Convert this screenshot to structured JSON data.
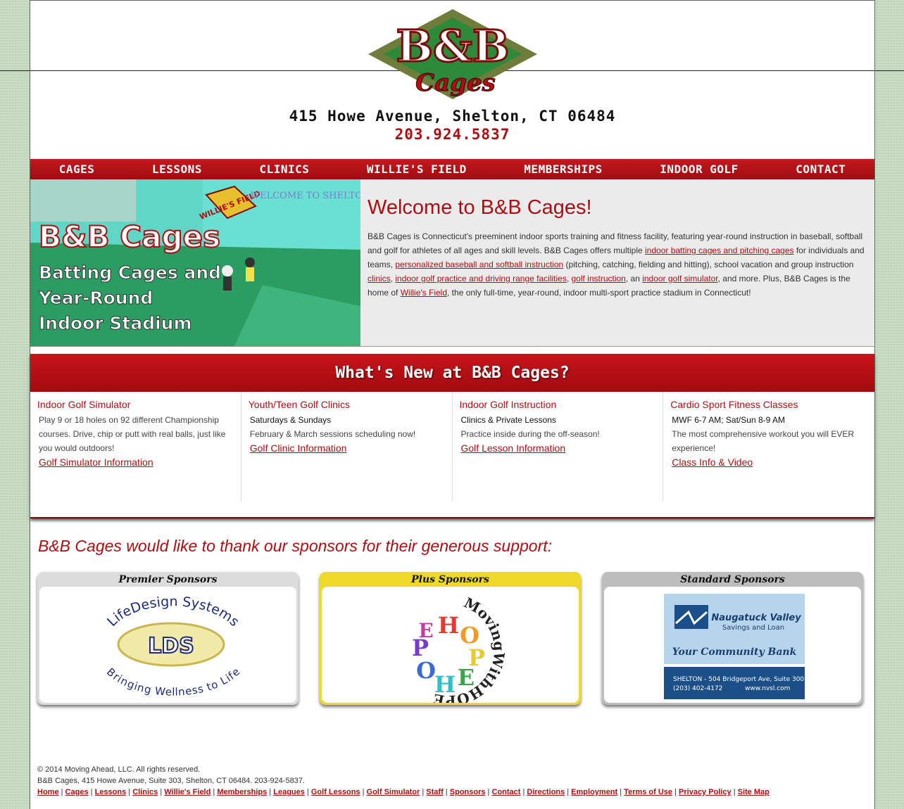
{
  "header": {
    "logo_top": "B&B",
    "logo_bottom": "Cages",
    "address": "415 Howe Avenue, Shelton, CT 06484",
    "phone": "203.924.5837"
  },
  "nav": [
    "CAGES",
    "LESSONS",
    "CLINICS",
    "WILLIE'S FIELD",
    "MEMBERSHIPS",
    "INDOOR GOLF",
    "CONTACT"
  ],
  "hero": {
    "image_title": "B&B Cages",
    "image_line1": "Batting Cages and",
    "image_line2": "Year-Round",
    "image_line3": "Indoor Stadium",
    "sign_welcome": "WELCOME TO SHELTON",
    "sign_field": "WILLIE'S FIELD",
    "heading": "Welcome to B&B Cages!",
    "p1": "B&B Cages is Connecticut's preeminent indoor sports training and fitness facility, featuring year-round instruction in baseball, softball and golf for athletes of all ages and skill levels. B&B Cages offers multiple ",
    "link1": "indoor batting cages and pitching cages",
    "p2": " for individuals and teams, ",
    "link2": "personalized baseball and softball instruction",
    "p3": " (pitching, catching, fielding and hitting), school vacation and group instruction ",
    "link3": "clinics",
    "p4": ", ",
    "link4": "indoor golf practice and driving range facilities",
    "p5": ", ",
    "link5": "golf instruction",
    "p6": ", an ",
    "link6": "indoor golf simulator",
    "p7": ", and more. Plus, B&B Cages is the home of ",
    "link7": "Willie's Field",
    "p8": ", the only full-time, year-round, indoor multi-sport practice stadium in Connecticut!"
  },
  "news": {
    "title": "What's New at B&B Cages?",
    "items": [
      {
        "title": "Indoor Golf Simulator",
        "sub": "",
        "text": "Play 9 or 18 holes on 92 different Championship courses. Drive, chip or putt with real balls, just like you would outdoors!",
        "link": "Golf Simulator Information"
      },
      {
        "title": "Youth/Teen Golf Clinics",
        "sub": "Saturdays & Sundays",
        "text": "February & March sessions scheduling now!",
        "link": "Golf Clinic Information"
      },
      {
        "title": "Indoor Golf Instruction",
        "sub": "Clinics & Private Lessons",
        "text": "Practice inside during the off-season!",
        "link": "Golf Lesson Information"
      },
      {
        "title": "Cardio Sport Fitness Classes",
        "sub": "MWF 6-7 AM; Sat/Sun 8-9 AM",
        "text": "The most comprehensive workout you will EVER experience!",
        "link": "Class Info & Video"
      }
    ]
  },
  "sponsors": {
    "thanks": "B&B Cages would like to thank our sponsors for their generous support:",
    "premier": "Premier Sponsors",
    "plus": "Plus Sponsors",
    "standard": "Standard Sponsors",
    "lds_top": "LifeDesign Systems",
    "lds_mid": "LDS",
    "lds_bottom": "Bringing Wellness to Life",
    "hope_ring": "MovingWithHOPE",
    "nvsl_name1": "Naugatuck Valley",
    "nvsl_name2": "Savings and Loan",
    "nvsl_tag": "Your Community Bank",
    "nvsl_addr": "SHELTON - 504 Bridgeport Ave, Suite 300",
    "nvsl_phone": "(203) 402-4172",
    "nvsl_web": "www.nvsl.com"
  },
  "footer": {
    "copyright": "© 2014 Moving Ahead, LLC. All rights reserved.",
    "address": "B&B Cages, 415 Howe Avenue, Suite 303, Shelton, CT 06484. 203-924-5837.",
    "links": [
      "Home",
      "Cages",
      "Lessons",
      "Clinics",
      "Willie's Field",
      "Memberships",
      "Leagues",
      "Golf Lessons",
      "Golf Simulator",
      "Staff",
      "Sponsors",
      "Contact",
      "Directions",
      "Employment",
      "Terms of Use",
      "Privacy Policy",
      "Site Map"
    ]
  },
  "colors": {
    "brand_red": "#b00d12",
    "field_green": "#2aa56a",
    "page_bg": "#c9dcc4"
  }
}
